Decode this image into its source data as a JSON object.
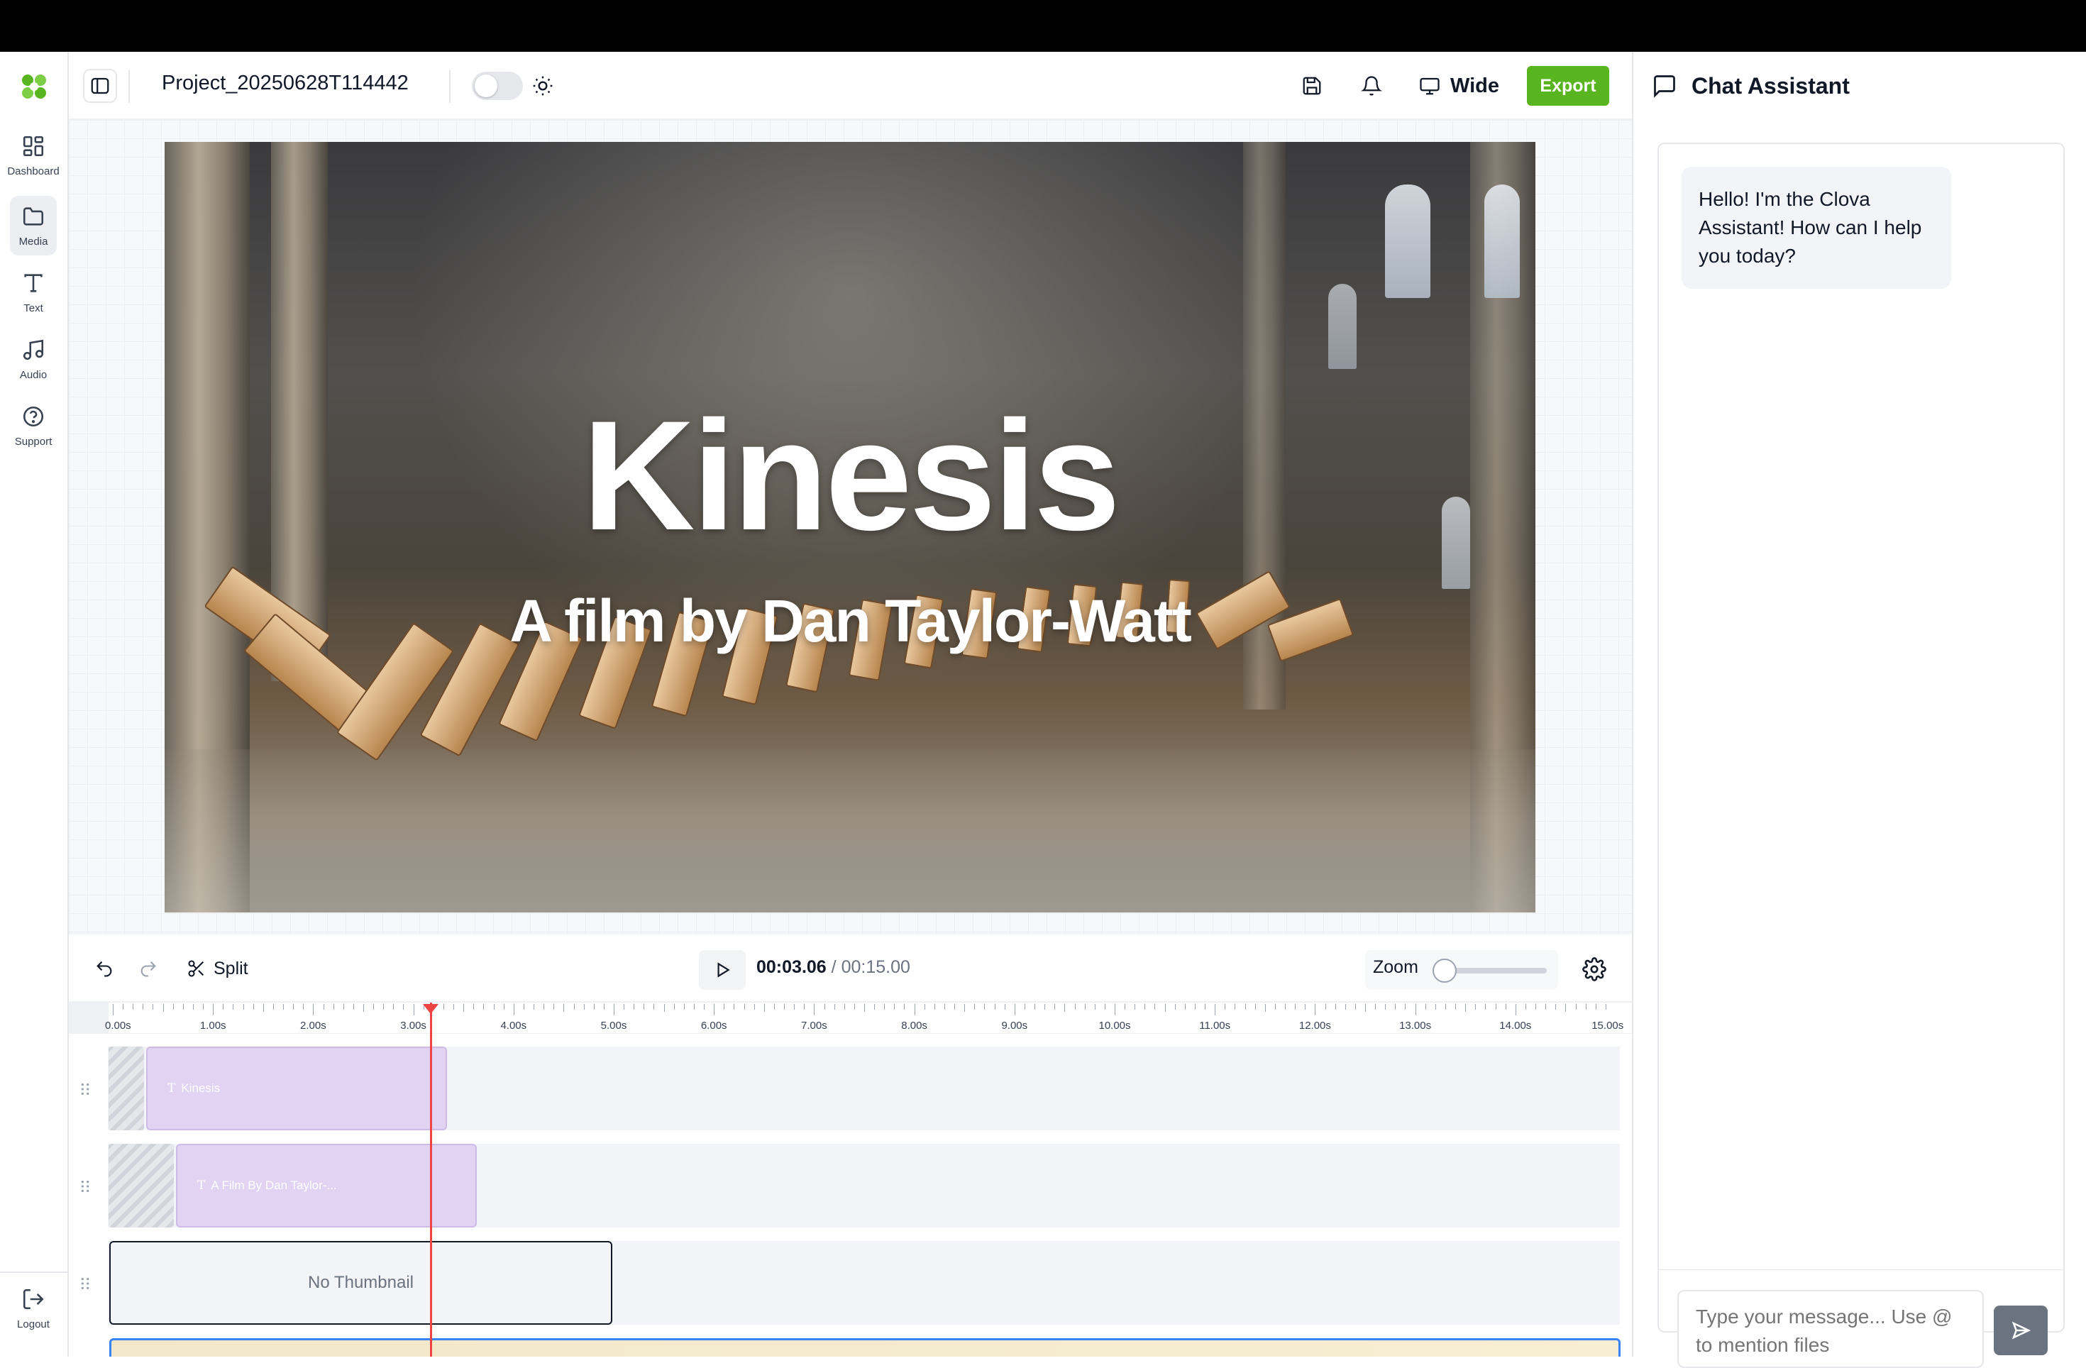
{
  "app": {
    "project_name": "Project_20250628T114442",
    "accent_color": "#59b51f",
    "dark_mode": false
  },
  "sidebar": {
    "items": [
      {
        "label": "Dashboard",
        "icon": "grid-icon"
      },
      {
        "label": "Media",
        "icon": "folder-icon"
      },
      {
        "label": "Text",
        "icon": "type-icon"
      },
      {
        "label": "Audio",
        "icon": "music-icon"
      },
      {
        "label": "Support",
        "icon": "help-circle-icon"
      }
    ],
    "active": "Media",
    "logout_label": "Logout"
  },
  "header": {
    "aspect_label": "Wide",
    "export_label": "Export"
  },
  "preview": {
    "title": "Kinesis",
    "subtitle": "A film by Dan Taylor-Watt"
  },
  "timeline_toolbar": {
    "split_label": "Split",
    "current_time": "00:03.06",
    "separator": "/",
    "total_time": "00:15.00",
    "zoom_label": "Zoom",
    "zoom_level": 0
  },
  "timeline": {
    "ruler_labels": [
      "0.00s",
      "1.00s",
      "2.00s",
      "3.00s",
      "4.00s",
      "5.00s",
      "6.00s",
      "7.00s",
      "8.00s",
      "9.00s",
      "10.00s",
      "11.00s",
      "12.00s",
      "13.00s",
      "14.00s",
      "15.00s"
    ],
    "playhead_seconds": 3.06,
    "clips": [
      {
        "track": 1,
        "type": "text",
        "label": "Kinesis"
      },
      {
        "track": 2,
        "type": "text",
        "label": "A Film By Dan Taylor-..."
      },
      {
        "track": 3,
        "type": "media",
        "label": "No Thumbnail"
      },
      {
        "track": 4,
        "type": "audio",
        "label": ""
      }
    ]
  },
  "chat": {
    "title": "Chat Assistant",
    "messages": [
      {
        "role": "assistant",
        "text": "Hello! I'm the Clova Assistant! How can I help you today?"
      }
    ],
    "input_placeholder": "Type your message... Use @ to mention files"
  }
}
